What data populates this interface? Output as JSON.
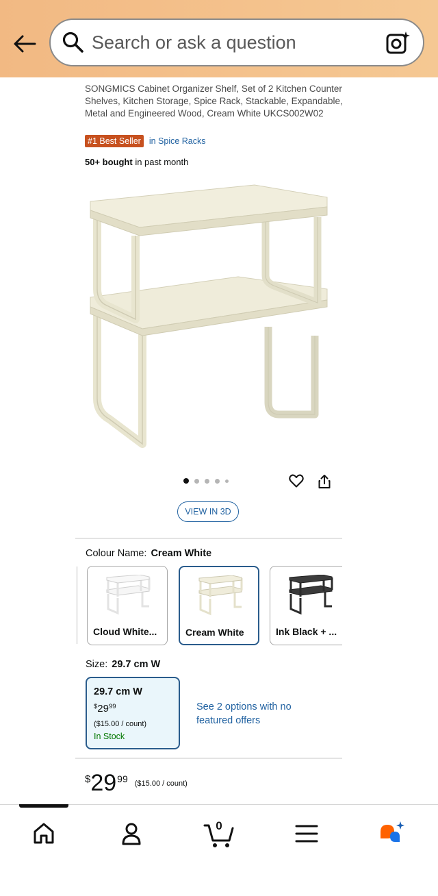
{
  "header": {
    "search_placeholder": "Search or ask a question"
  },
  "product": {
    "title": "SONGMICS Cabinet Organizer Shelf, Set of 2 Kitchen Counter Shelves, Kitchen Storage, Spice Rack, Stackable, Expandable, Metal and Engineered Wood, Cream White UKCS002W02",
    "badge": "#1 Best Seller",
    "badge_category": "in Spice Racks",
    "bought_bold": "50+ bought",
    "bought_rest": " in past month",
    "image_count": 5,
    "active_image": 1,
    "view_3d_label": "VIEW IN 3D"
  },
  "colour": {
    "label": "Colour Name:",
    "selected": "Cream White",
    "options": [
      {
        "label": "Cloud White...",
        "selected": false
      },
      {
        "label": "Cream White",
        "selected": true
      },
      {
        "label": "Ink Black + ...",
        "selected": false
      }
    ]
  },
  "size": {
    "label": "Size:",
    "selected": "29.7 cm W",
    "card": {
      "name": "29.7 cm W",
      "currency": "$",
      "whole": "29",
      "fraction": "99",
      "unit_price": "($15.00 / count)",
      "stock": "In Stock"
    },
    "see_options": "See 2 options with no featured offers"
  },
  "price": {
    "currency": "$",
    "whole": "29",
    "fraction": "99",
    "unit_price": "($15.00 / count)"
  },
  "nav": {
    "cart_count": "0",
    "items": [
      "home",
      "account",
      "cart",
      "menu",
      "rufus"
    ]
  },
  "colors": {
    "header_bg": "#f2b983",
    "accent_blue": "#2162a1",
    "selected_border": "#2a5c8c",
    "badge": "#c7511f",
    "in_stock": "#007600",
    "rufus_orange": "#ff6200",
    "rufus_blue": "#1a73e8"
  }
}
